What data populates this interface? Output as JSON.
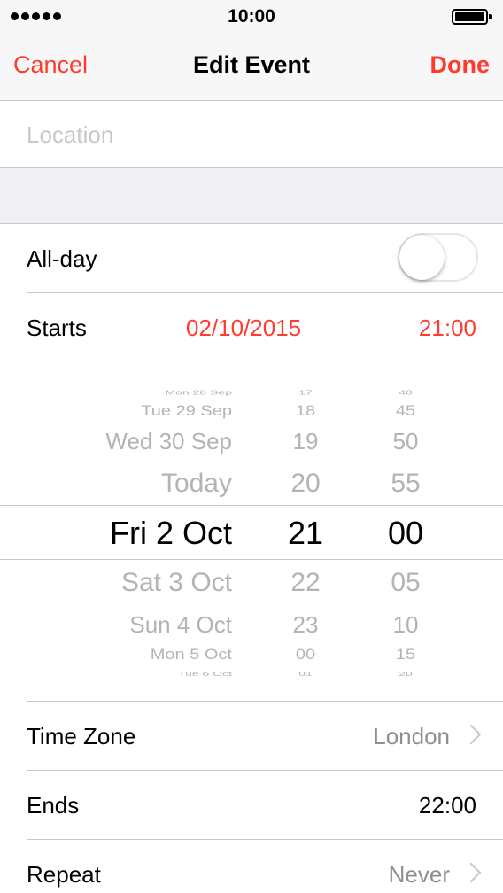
{
  "status": {
    "time": "10:00"
  },
  "nav": {
    "cancel_label": "Cancel",
    "title": "Edit Event",
    "done_label": "Done"
  },
  "location": {
    "value": "",
    "placeholder": "Location"
  },
  "allday": {
    "label": "All-day",
    "on": false
  },
  "starts": {
    "label": "Starts",
    "date": "02/10/2015",
    "time": "21:00"
  },
  "picker": {
    "days": [
      "Mon 28 Sep",
      "Tue 29 Sep",
      "Wed 30 Sep",
      "Today",
      "Fri 2 Oct",
      "Sat 3 Oct",
      "Sun 4 Oct",
      "Mon 5 Oct",
      "Tue 6 Oct"
    ],
    "hours": [
      "17",
      "18",
      "19",
      "20",
      "21",
      "22",
      "23",
      "00",
      "01"
    ],
    "minutes": [
      "40",
      "45",
      "50",
      "55",
      "00",
      "05",
      "10",
      "15",
      "20"
    ],
    "selected_index": 4
  },
  "timezone": {
    "label": "Time Zone",
    "value": "London"
  },
  "ends": {
    "label": "Ends",
    "value": "22:00"
  },
  "repeat": {
    "label": "Repeat",
    "value": "Never"
  },
  "colors": {
    "accent": "#ff3b30",
    "secondary_text": "#8e8e93",
    "placeholder": "#c7c7cd",
    "separator": "#c8c7cc",
    "group_background": "#efeff4",
    "bar_background": "#f7f7f7"
  }
}
